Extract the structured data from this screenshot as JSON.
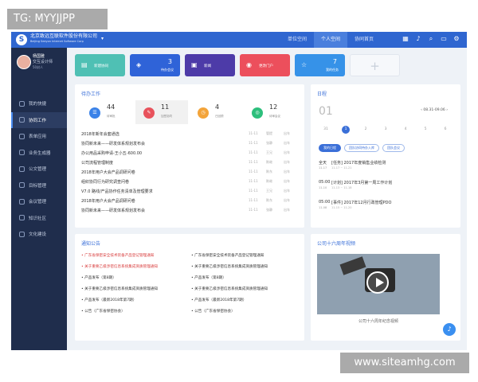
{
  "watermark": {
    "tg": "TG: MYYJJPP",
    "site": "www.siteamhg.com"
  },
  "header": {
    "logo_char": "S",
    "company": "北京致远互联软件股份有限公司",
    "company_en": "Beijing Seeyon Internet Software Corp",
    "nav": [
      "单位空间",
      "个人空间",
      "协同首页"
    ],
    "active_nav": "个人空间",
    "icons": [
      "apps-icon",
      "bell-icon",
      "search-icon",
      "chat-icon",
      "settings-icon"
    ]
  },
  "user": {
    "name": "杨国雅",
    "dept": "交互设计师",
    "count": "50封人"
  },
  "sidebar": {
    "items": [
      {
        "label": "我的快捷",
        "active": false
      },
      {
        "label": "协同工作",
        "active": true
      },
      {
        "label": "表单应用",
        "active": false
      },
      {
        "label": "业务生成器",
        "active": false
      },
      {
        "label": "公文管理",
        "active": false
      },
      {
        "label": "目标管理",
        "active": false
      },
      {
        "label": "会议管理",
        "active": false
      },
      {
        "label": "知识社区",
        "active": false
      },
      {
        "label": "文化建设",
        "active": false
      }
    ]
  },
  "tiles": [
    {
      "label": "新建协同",
      "count": "",
      "color": "#4fc0b4",
      "icon": "doc-icon"
    },
    {
      "label": "待办会议",
      "count": "3",
      "color": "#2f63d8",
      "icon": "meeting-icon"
    },
    {
      "label": "新闻",
      "count": "",
      "color": "#4d3ba8",
      "icon": "news-icon"
    },
    {
      "label": "更改门户",
      "count": "",
      "color": "#ec4f5c",
      "icon": "portal-icon"
    },
    {
      "label": "我的任务",
      "count": "7",
      "color": "#3692e8",
      "icon": "task-icon"
    }
  ],
  "todo": {
    "title": "待办工作",
    "stats": [
      {
        "num": "44",
        "label": "待审批",
        "color": "#3a82e8"
      },
      {
        "num": "11",
        "label": "加签协同",
        "color": "#e8525c"
      },
      {
        "num": "4",
        "label": "已回顾",
        "color": "#f3a43a"
      },
      {
        "num": "12",
        "label": "待审会议",
        "color": "#2dbf7c"
      }
    ],
    "items": [
      {
        "title": "2018年新年会套通选",
        "time": "11-11",
        "person": "管提",
        "status": "出车"
      },
      {
        "title": "协同新未来——研发体系规划发布会",
        "time": "11-11",
        "person": "张静",
        "status": "出车"
      },
      {
        "title": "办公用品采购申请-王小五-600.00",
        "time": "11-11",
        "person": "王兄",
        "status": "出车"
      },
      {
        "title": "公司流程管理制度",
        "time": "11-11",
        "person": "陈继",
        "status": "出车"
      },
      {
        "title": "2018年用户大会产品调研问卷",
        "time": "11-11",
        "person": "陈东",
        "status": "出车"
      },
      {
        "title": "组织协同行为研究调查问卷",
        "time": "11-11",
        "person": "陈继",
        "status": "出车"
      },
      {
        "title": "V7.0 路线/产品协作任务清单及管理要求",
        "time": "11-11",
        "person": "王兄",
        "status": "出车"
      },
      {
        "title": "2018年用户大会产品调研问卷",
        "time": "11-11",
        "person": "陈东",
        "status": "出车"
      },
      {
        "title": "协同新未来——研发体系规划发布会",
        "time": "11-11",
        "person": "张静",
        "status": "出车"
      }
    ]
  },
  "schedule": {
    "title": "日程",
    "big_date": "01",
    "range": "08.31-09.06",
    "days": [
      "31",
      "1",
      "2",
      "3",
      "4",
      "5",
      "6"
    ],
    "selected_day": "1",
    "pills": [
      "我的日程",
      "团队协同待办入库",
      "团队会议"
    ],
    "active_pill": "我的日程",
    "entries": [
      {
        "time": "全天",
        "date": "11-17",
        "text": "[任务] 2017年度销售业绩检测",
        "sub": "11-17 ~ 11-21"
      },
      {
        "time": "05:00",
        "date": "11-10",
        "text": "[计划] 2017年3月第一周工作计划",
        "sub": "11-13 ~ 11-18"
      },
      {
        "time": "05:00",
        "date": "11-08",
        "text": "[事件] 2017年12月行政管理PDO",
        "sub": "11-15 ~ 11-20"
      }
    ]
  },
  "notices": {
    "title": "通知公告",
    "items": [
      {
        "col": "left",
        "text": "• 广东省保密安全技术装备产品登记管理通知",
        "style": "red"
      },
      {
        "col": "right",
        "text": "• 广东省保密安全技术装备产品登记管理通知",
        "style": "dark"
      },
      {
        "col": "left",
        "text": "• 关于重要乙级涉密信息系统集成资质管理通知",
        "style": "red"
      },
      {
        "col": "right",
        "text": "• 关于重要乙级涉密信息系统集成资质管理通知",
        "style": "dark"
      },
      {
        "col": "left",
        "text": "• 产品发布（第8期）",
        "style": "dark"
      },
      {
        "col": "right",
        "text": "• 产品发布（第8期）",
        "style": "dark"
      },
      {
        "col": "left",
        "text": "• 关于重要乙级涉密信息系统集成资质管理通知",
        "style": "dark"
      },
      {
        "col": "right",
        "text": "• 关于重要乙级涉密信息系统集成资质管理通知",
        "style": "dark"
      },
      {
        "col": "left",
        "text": "• 产品发布（最新2018年第7期）",
        "style": "dark"
      },
      {
        "col": "right",
        "text": "• 产品发布（最新2018年第7期）",
        "style": "dark"
      },
      {
        "col": "left",
        "text": "• 公告（广东省保密协会）",
        "style": "dark"
      },
      {
        "col": "right",
        "text": "• 公告（广东省保密协会）",
        "style": "dark"
      }
    ]
  },
  "video": {
    "title": "公司十六周年视频",
    "caption": "公司十六周年纪念视频"
  }
}
